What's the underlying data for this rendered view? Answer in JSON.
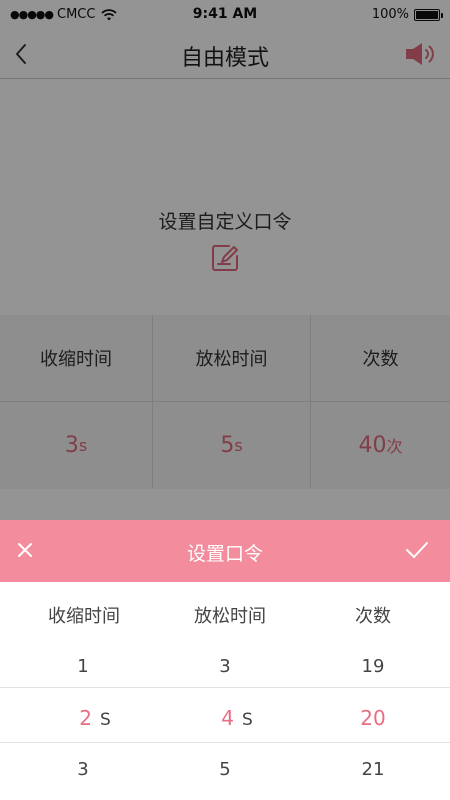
{
  "status_bar": {
    "signal_dots": "●●●●●",
    "carrier": "CMCC",
    "time": "9:41 AM",
    "battery_text": "100%",
    "battery_level": 1.0
  },
  "nav": {
    "title": "自由模式",
    "back_icon": "chevron-left-icon",
    "sound_icon": "speaker-icon"
  },
  "main": {
    "prompt_label": "设置自定义口令",
    "edit_icon": "edit-icon",
    "headers": [
      "收缩时间",
      "放松时间",
      "次数"
    ],
    "values": [
      {
        "value": "3",
        "unit": "s"
      },
      {
        "value": "5",
        "unit": "s"
      },
      {
        "value": "40",
        "unit": "次"
      }
    ]
  },
  "sheet": {
    "title": "设置口令",
    "close_icon": "close-icon",
    "confirm_icon": "check-icon",
    "columns": [
      "收缩时间",
      "放松时间",
      "次数"
    ],
    "picker": {
      "contraction": {
        "above": "1",
        "selected": "2",
        "below": "3",
        "unit": "S"
      },
      "relax": {
        "above": "3",
        "selected": "4",
        "below": "5",
        "unit": "S"
      },
      "count": {
        "above": "19",
        "selected": "20",
        "below": "21"
      }
    }
  },
  "colors": {
    "accent": "#e06a7d",
    "sheet_header": "#f38d9d",
    "overlay": "rgba(0,0,0,0.42)"
  }
}
